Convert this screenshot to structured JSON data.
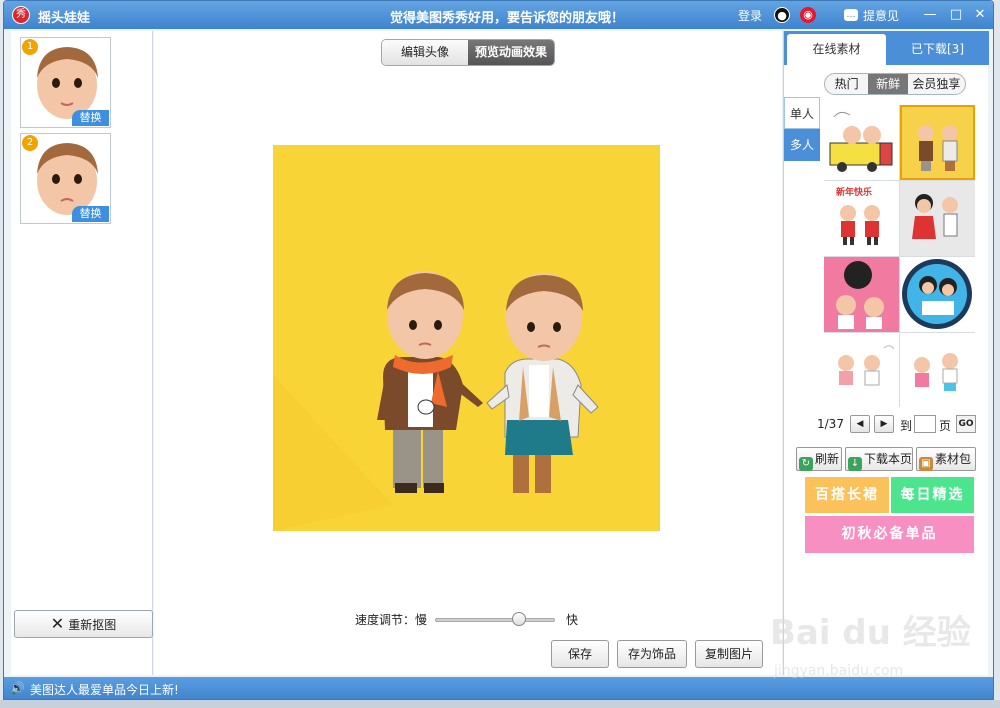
{
  "titlebar": {
    "app_logo": "秀",
    "app_title": "摇头娃娃",
    "slogan": "觉得美图秀秀好用，要告诉您的朋友哦！",
    "login": "登录",
    "feedback": "提意见"
  },
  "left_panel": {
    "thumbnails": [
      {
        "number": "1",
        "replace_label": "替换"
      },
      {
        "number": "2",
        "replace_label": "替换"
      }
    ],
    "reclip_label": "重新抠图"
  },
  "main": {
    "segments": [
      "编辑头像",
      "预览动画效果"
    ],
    "active_segment": "预览动画效果",
    "speed_label": "速度调节：慢",
    "speed_fast_label": "快",
    "speed_value": 0.7,
    "buttons": {
      "save": "保存",
      "save_as_decoration": "存为饰品",
      "copy_image": "复制图片"
    }
  },
  "right_panel": {
    "tabs": [
      "在线素材",
      "已下载[3]"
    ],
    "filters": [
      "热门",
      "新鲜",
      "会员独享"
    ],
    "active_filter": "新鲜",
    "side_tabs": [
      "单人",
      "多人"
    ],
    "active_side_tab": "多人",
    "grid_cells": 8,
    "selected_cell": 2,
    "cell_text": {
      "new_year": "新年快乐"
    },
    "pager": {
      "text": "1/37",
      "to": "到",
      "page": "页",
      "go": "GO"
    },
    "actions": {
      "refresh": "刷新",
      "download_page": "下载本页",
      "pack": "素材包"
    },
    "banners": [
      "百搭长裙",
      "每日精选",
      "初秋必备单品"
    ]
  },
  "statusbar": {
    "text": "美图达人最爱单品今日上新!"
  },
  "watermark": {
    "logo": "Bai du 经验",
    "url": "jingyan.baidu.com"
  },
  "colors": {
    "title_blue": "#3e83cf",
    "preview_bg": "#f9d437",
    "banner_orange": "#fbc25b",
    "banner_green": "#4ce58e",
    "banner_pink": "#f78fc2"
  }
}
